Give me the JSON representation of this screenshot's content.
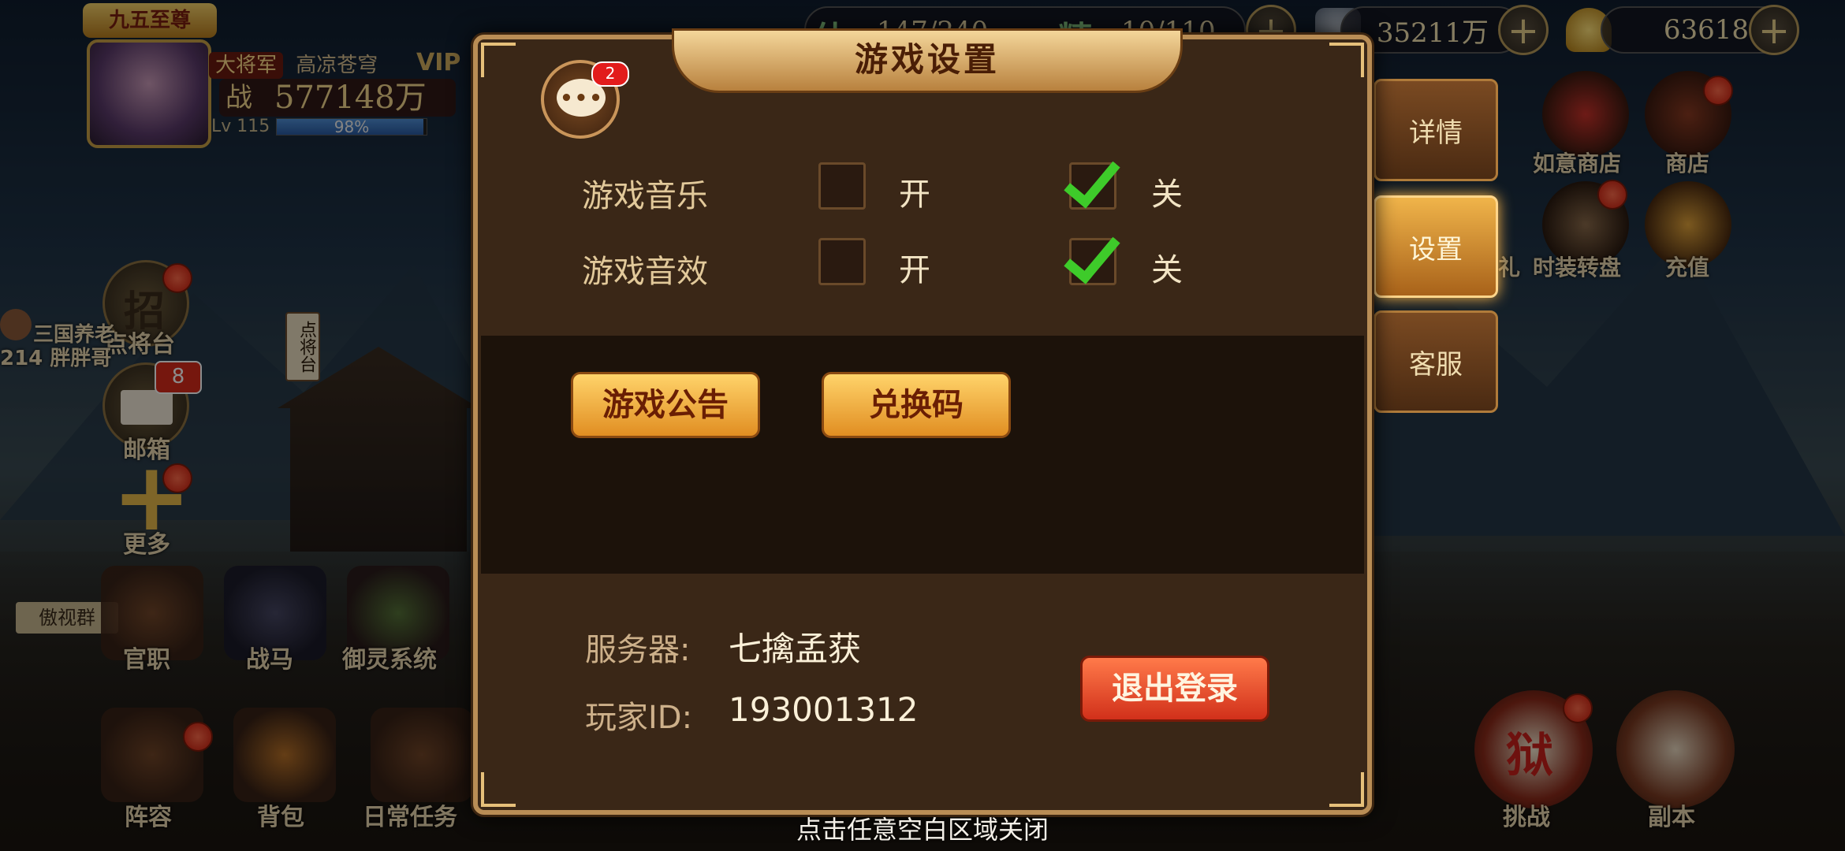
{
  "top_bar": {
    "stamina_label": "体",
    "stamina_value": "147/240",
    "energy_label": "精",
    "energy_value": "10/110",
    "silver_value": "35211万",
    "gold_value": "63618"
  },
  "player": {
    "rank_badge": "九五至尊",
    "title_tag": "大将军",
    "name": "高凉苍穹",
    "vip_label": "VIP",
    "power_prefix": "战",
    "power_value": "577148万",
    "level": "Lv 115",
    "exp_percent": "98%",
    "exp_fraction": 0.98
  },
  "left_menu": {
    "recruit": "点将台",
    "recruit_icon_char": "招",
    "mail": "邮箱",
    "mail_count": "8",
    "more": "更多",
    "friend_line1": "三国养老",
    "friend_line2": "214 胖胖哥",
    "banner_text": "傲视群",
    "tower_text": "点将台"
  },
  "bottom_bar": {
    "row1": [
      "官职",
      "战马",
      "御灵系统"
    ],
    "row2": [
      "阵容",
      "背包",
      "日常任务"
    ]
  },
  "right_icons": {
    "shop_ruyi": "如意商店",
    "shop": "商店",
    "gift_partial": "礼",
    "wheel": "时装转盘",
    "recharge": "充值",
    "challenge": "挑战",
    "dungeon": "副本",
    "challenge_icon_char": "狱"
  },
  "side_tabs": [
    {
      "label": "详情",
      "active": false
    },
    {
      "label": "设置",
      "active": true
    },
    {
      "label": "客服",
      "active": false
    }
  ],
  "dialog": {
    "title": "游戏设置",
    "chat_badge": "2",
    "chat_dots": "•••",
    "music_label": "游戏音乐",
    "sfx_label": "游戏音效",
    "on_label": "开",
    "off_label": "关",
    "music_on_checked": false,
    "music_off_checked": true,
    "sfx_on_checked": false,
    "sfx_off_checked": true,
    "announcement_button": "游戏公告",
    "redeem_button": "兑换码",
    "server_key": "服务器:",
    "server_value": "七擒孟获",
    "player_id_key": "玩家ID:",
    "player_id_value": "193001312",
    "logout_button": "退出登录"
  },
  "close_hint": "点击任意空白区域关闭"
}
